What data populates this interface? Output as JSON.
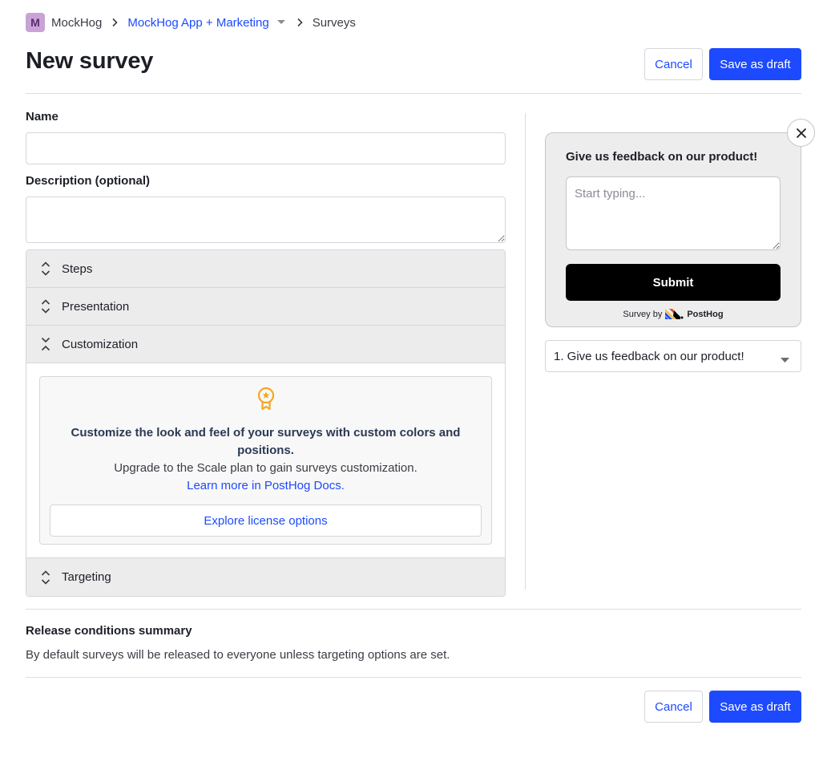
{
  "breadcrumb": {
    "org_initial": "M",
    "org": "MockHog",
    "project": "MockHog App + Marketing",
    "section": "Surveys"
  },
  "header": {
    "title": "New survey",
    "cancel_label": "Cancel",
    "save_label": "Save as draft"
  },
  "form": {
    "name_label": "Name",
    "name_value": "",
    "description_label": "Description (optional)",
    "description_value": ""
  },
  "accordion": {
    "sections": [
      "Steps",
      "Presentation",
      "Customization",
      "Targeting"
    ],
    "expanded": "Customization"
  },
  "customization": {
    "icon": "award-ribbon-icon",
    "title": "Customize the look and feel of your surveys with custom colors and positions.",
    "text": "Upgrade to the Scale plan to gain surveys customization.",
    "link": "Learn more in PostHog Docs.",
    "button": "Explore license options"
  },
  "preview": {
    "question": "Give us feedback on our product!",
    "placeholder": "Start typing...",
    "submit_label": "Submit",
    "survey_by": "Survey by",
    "brand": "PostHog",
    "selected_question": "1. Give us feedback on our product!"
  },
  "release": {
    "title": "Release conditions summary",
    "text": "By default surveys will be released to everyone unless targeting options are set."
  },
  "footer": {
    "cancel_label": "Cancel",
    "save_label": "Save as draft"
  },
  "colors": {
    "accent": "#1d4aff",
    "badge": "#c9a3d6",
    "award": "#f5a623"
  }
}
